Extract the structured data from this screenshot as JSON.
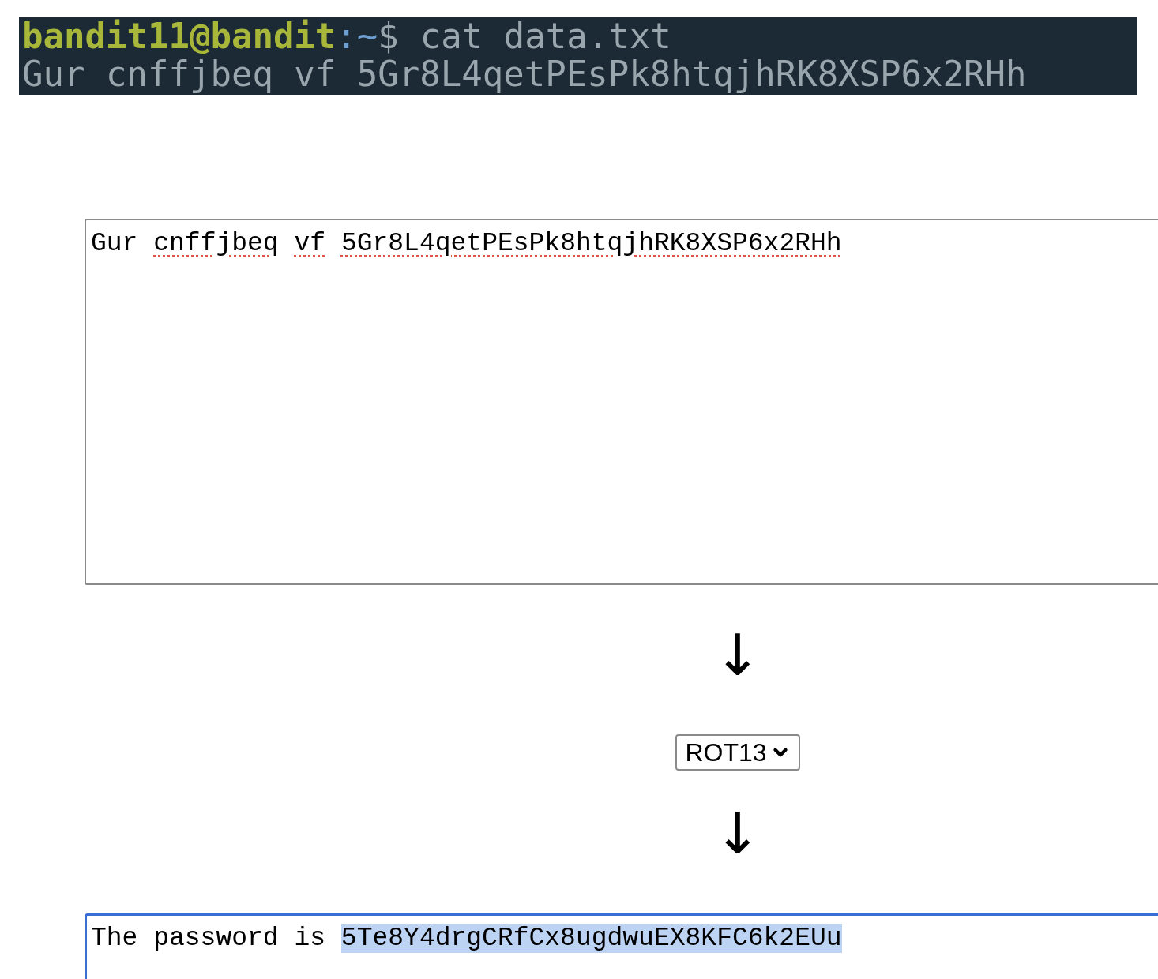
{
  "terminal": {
    "user_host": "bandit11@bandit",
    "path": ":~",
    "prompt_sign": "$",
    "command": "cat data.txt",
    "output": "Gur cnffjbeq vf 5Gr8L4qetPEsPk8htqjhRK8XSP6x2RHh"
  },
  "input_box": {
    "focused": false,
    "words": [
      {
        "text": "Gur",
        "misspelled": false
      },
      {
        "text": "cnffjbeq",
        "misspelled": true
      },
      {
        "text": "vf",
        "misspelled": true
      },
      {
        "text": "5Gr8L4qetPEsPk8htqjhRK8XSP6x2RHh",
        "misspelled": true
      }
    ]
  },
  "arrow_1": "↓",
  "cipher_select": {
    "value": "ROT13"
  },
  "arrow_2": "↓",
  "output_box": {
    "focused": true,
    "text": "The password is ",
    "selected_text": "5Te8Y4drgCRfCx8ugdwuEX8KFC6k2EUu"
  }
}
